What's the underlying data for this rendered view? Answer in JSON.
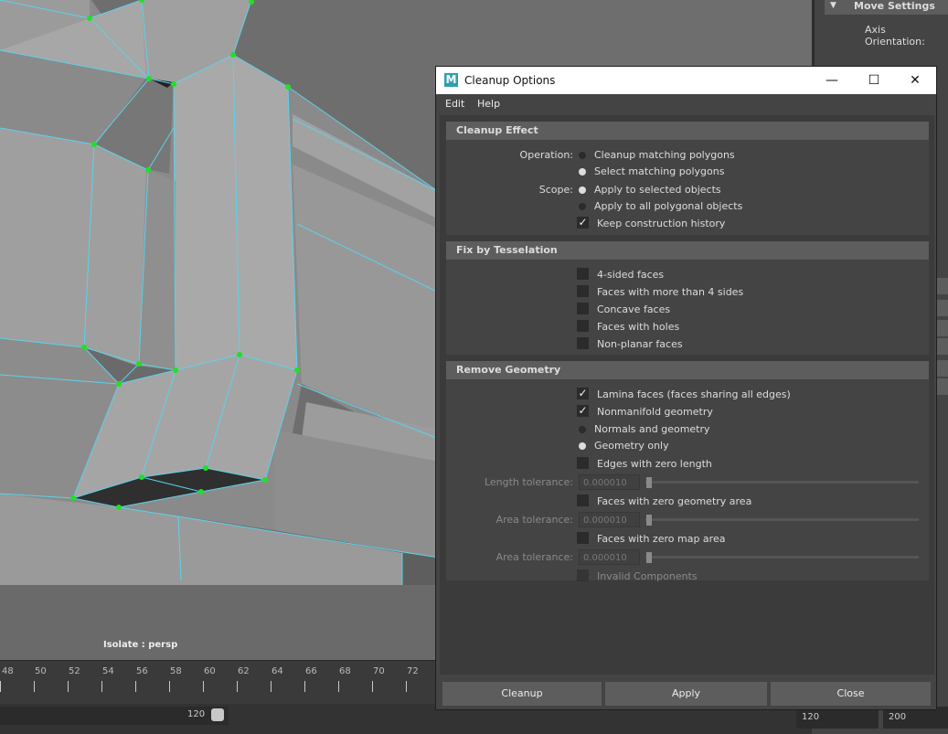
{
  "viewport": {
    "isolate_label": "Isolate : persp"
  },
  "timeline": {
    "ticks": [
      "48",
      "50",
      "52",
      "54",
      "56",
      "58",
      "60",
      "62",
      "64",
      "66",
      "68",
      "70",
      "72"
    ],
    "range_value": "120",
    "end_left": "120",
    "end_right": "200"
  },
  "attribute_editor": {
    "header": "Move Settings",
    "axis_orientation_label": "Axis Orientation:"
  },
  "dialog": {
    "title": "Cleanup Options",
    "menu": [
      "Edit",
      "Help"
    ],
    "cleanup_effect": {
      "title": "Cleanup Effect",
      "operation_label": "Operation:",
      "operation_options": [
        "Cleanup matching polygons",
        "Select matching polygons"
      ],
      "operation_selected": "Select matching polygons",
      "scope_label": "Scope:",
      "scope_options": [
        "Apply to selected objects",
        "Apply to all polygonal objects"
      ],
      "scope_selected": "Apply to selected objects",
      "keep_history": "Keep construction history",
      "keep_history_checked": true
    },
    "fix_tesselation": {
      "title": "Fix by Tesselation",
      "options": [
        "4-sided faces",
        "Faces with more than 4 sides",
        "Concave faces",
        "Faces with holes",
        "Non-planar faces"
      ]
    },
    "remove_geometry": {
      "title": "Remove Geometry",
      "lamina": "Lamina faces (faces sharing all edges)",
      "lamina_checked": true,
      "nonmanifold": "Nonmanifold geometry",
      "nonmanifold_checked": true,
      "nonmanifold_options": [
        "Normals and geometry",
        "Geometry only"
      ],
      "nonmanifold_selected": "Geometry only",
      "zero_length_edges": "Edges with zero length",
      "length_tolerance_label": "Length tolerance:",
      "length_tolerance_value": "0.000010",
      "zero_geometry_area": "Faces with zero geometry area",
      "area_tolerance_label": "Area tolerance:",
      "area_tolerance_value": "0.000010",
      "zero_map_area": "Faces with zero map area",
      "map_area_tolerance_label": "Area tolerance:",
      "map_area_tolerance_value": "0.000010",
      "invalid_components": "Invalid Components"
    },
    "buttons": {
      "cleanup": "Cleanup",
      "apply": "Apply",
      "close": "Close"
    }
  }
}
